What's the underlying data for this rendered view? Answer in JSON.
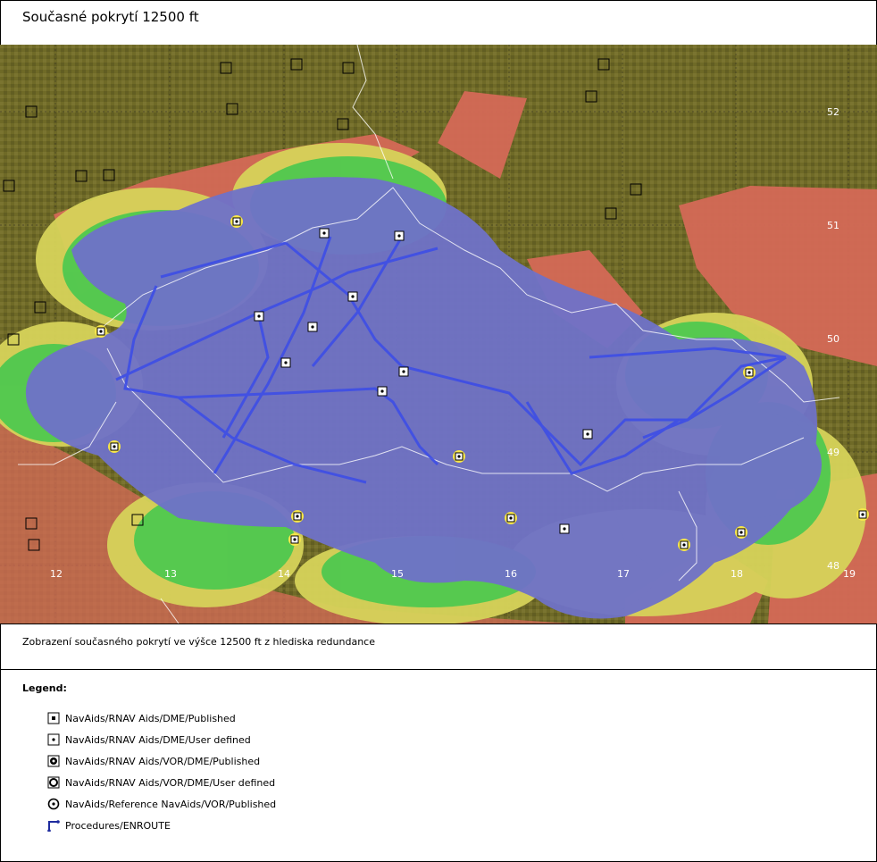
{
  "title": "Současné pokrytí 12500 ft",
  "caption": "Zobrazení současného pokrytí ve výšce 12500 ft z hlediska redundance",
  "map": {
    "longitude_labels": [
      "12",
      "13",
      "14",
      "15",
      "16",
      "17",
      "18",
      "19"
    ],
    "latitude_labels": [
      "52",
      "51",
      "50",
      "49",
      "48"
    ],
    "colors": {
      "background": "#6f6a27",
      "coverage_blue": "#6f72c8",
      "coverage_green": "#4fc94f",
      "coverage_yellow": "#d6d35a",
      "coverage_red": "#d46a57",
      "route_line": "#3d4de6",
      "border_line": "#ffffff"
    }
  },
  "legend": {
    "heading": "Legend:",
    "items": [
      {
        "icon": "dme-published-icon",
        "label": "NavAids/RNAV Aids/DME/Published"
      },
      {
        "icon": "dme-user-defined-icon",
        "label": "NavAids/RNAV Aids/DME/User defined"
      },
      {
        "icon": "vor-dme-published-icon",
        "label": "NavAids/RNAV Aids/VOR/DME/Published"
      },
      {
        "icon": "vor-dme-user-defined-icon",
        "label": "NavAids/RNAV Aids/VOR/DME/User defined"
      },
      {
        "icon": "reference-vor-icon",
        "label": "NavAids/Reference NavAids/VOR/Published"
      },
      {
        "icon": "enroute-procedure-icon",
        "label": "Procedures/ENROUTE"
      }
    ]
  }
}
